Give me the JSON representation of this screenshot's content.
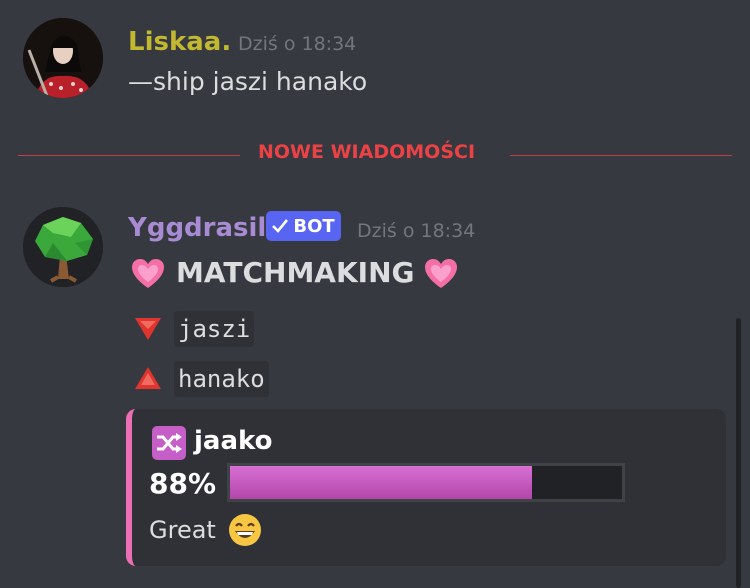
{
  "messages": [
    {
      "author": "Liskaa.",
      "author_color": "#c3b930",
      "timestamp": "Dziś o 18:34",
      "text": "—ship jaszi hanako"
    },
    {
      "author": "Yggdrasil",
      "author_color": "#a98bd4",
      "badge": "BOT",
      "timestamp": "Dziś o 18:34",
      "title": "MATCHMAKING",
      "down_name": "jaszi",
      "up_name": "hanako",
      "embed": {
        "title": "jaako",
        "percent_label": "88%",
        "progress": 0.77,
        "verdict": "Great",
        "accent_color": "#eb6fb4"
      }
    }
  ],
  "divider": {
    "label": "NOWE WIADOMOŚCI",
    "color": "#ed4245"
  },
  "icons": {
    "avatar1": "girl-avatar-photo",
    "avatar2": "tree-avatar-icon",
    "heart": "growing-heart-emoji",
    "down": "red-down-triangle-emoji",
    "up": "red-up-triangle-emoji",
    "shuffle": "twisted-arrows-emoji",
    "smiley": "grinning-face-emoji",
    "check": "checkmark-icon"
  }
}
